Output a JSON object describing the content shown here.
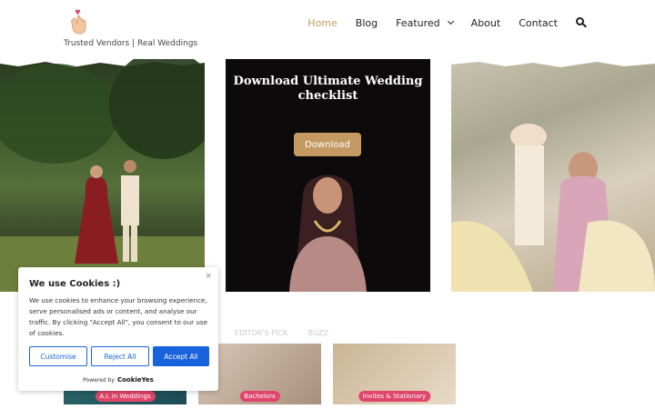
{
  "header": {
    "logo_icon": "hand-heart-icon",
    "tagline": "Trusted Vendors | Real Weddings",
    "nav": [
      {
        "label": "Home",
        "active": true
      },
      {
        "label": "Blog"
      },
      {
        "label": "Featured",
        "has_dropdown": true
      },
      {
        "label": "About"
      },
      {
        "label": "Contact"
      }
    ],
    "search_icon": "search-icon",
    "accent_color": "#c49a5a"
  },
  "hero": {
    "left_image": "bride-and-groom-in-garden-photo",
    "middle": {
      "title_line1": "Download Ultimate Wedding",
      "title_line2": "checklist",
      "button_label": "Download",
      "image": "bride-portrait-photo"
    },
    "right_image": "bride-entry-under-canopy-photo"
  },
  "section": {
    "tabs": [
      "EDITOR'S PICK",
      "BUZZ"
    ],
    "cards": [
      {
        "tag": "A.I. in Weddings"
      },
      {
        "tag": "Bachelors"
      },
      {
        "tag": "Invites & Stationary"
      }
    ],
    "tag_color": "#e0466b"
  },
  "cookie_banner": {
    "title": "We use Cookies :)",
    "body": "We use cookies to enhance your browsing experience, serve personalised ads or content, and analyse our traffic. By clicking \"Accept All\", you consent to our use of cookies.",
    "buttons": {
      "customise": "Customise",
      "reject": "Reject All",
      "accept": "Accept All"
    },
    "powered_by": "Powered by",
    "brand": "CookieYes",
    "close": "×",
    "primary_color": "#1863dc"
  }
}
